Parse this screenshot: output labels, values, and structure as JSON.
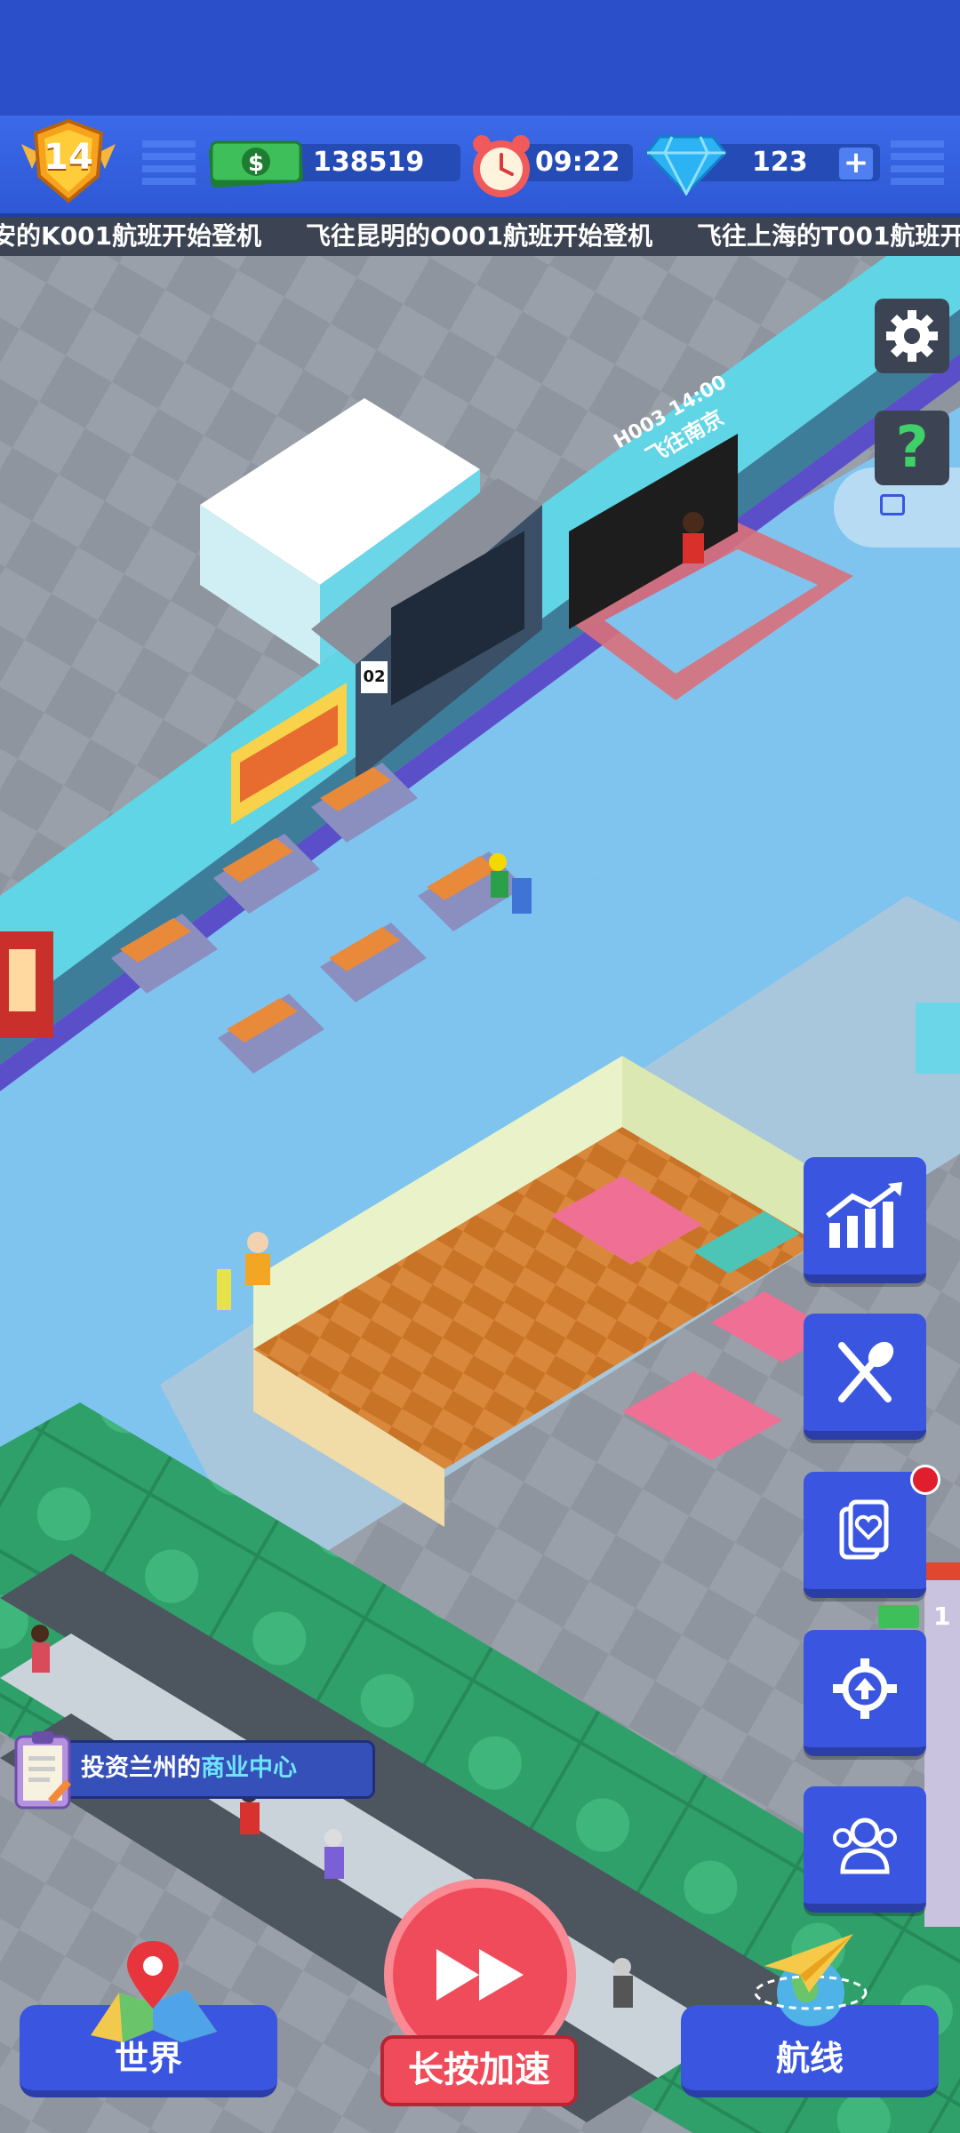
{
  "hud": {
    "level": "14",
    "cash": "138519",
    "clock": "09:22",
    "gems": "123"
  },
  "ticker": [
    "安的K001航班开始登机",
    "飞往昆明的O001航班开始登机",
    "飞往上海的T001航班开始登"
  ],
  "board": {
    "line1": "H003 14:00",
    "line2": "飞往南京"
  },
  "gate_number": "02",
  "shop_price_partial": "1",
  "quest": {
    "prefix": "投资兰州的",
    "highlight": "商业中心"
  },
  "bottom": {
    "world_label": "世界",
    "speed_label": "长按加速",
    "routes_label": "航线"
  },
  "icons": {
    "settings": "gear-icon",
    "help": "question-icon",
    "stats": "stats-chart-icon",
    "food": "fork-spoon-icon",
    "service": "feedback-heart-icon",
    "upgrade": "upgrade-gear-icon",
    "staff": "staff-people-icon"
  },
  "colors": {
    "hud_blue": "#2e58d6",
    "button_blue": "#3a56e0",
    "cash_green": "#2fa84a",
    "quest_text_highlight": "#6fe3ff",
    "speed_red": "#ef4b5a"
  }
}
